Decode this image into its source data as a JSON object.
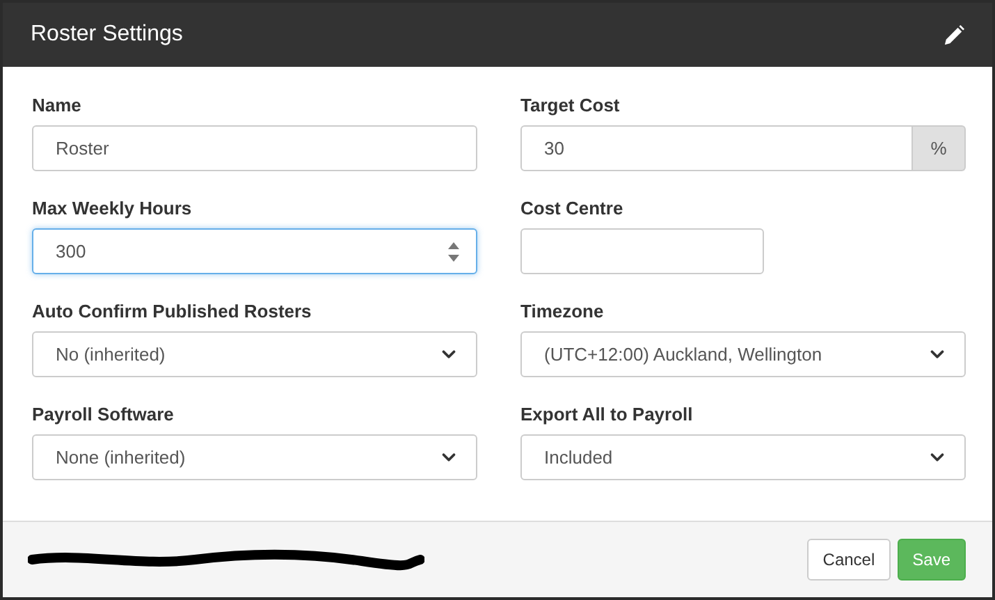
{
  "window": {
    "title": "Roster Settings"
  },
  "fields": [
    {
      "label": "Name",
      "kind": "text",
      "value": "Roster",
      "focused": false
    },
    {
      "label": "Target Cost",
      "kind": "addon",
      "value": "30",
      "addon": "%",
      "focused": false
    },
    {
      "label": "Max Weekly Hours",
      "kind": "number",
      "value": "300",
      "focused": true
    },
    {
      "label": "Cost Centre",
      "kind": "short",
      "focused": false
    },
    {
      "label": "Auto Confirm Published Rosters",
      "kind": "select",
      "value": "No (inherited)",
      "focused": false
    },
    {
      "label": "Timezone",
      "kind": "select",
      "value": "(UTC+12:00) Auckland, Wellington",
      "focused": false
    },
    {
      "label": "Payroll Software",
      "kind": "select",
      "value": "None (inherited)",
      "focused": false
    },
    {
      "label": "Export All to Payroll",
      "kind": "select",
      "value": "Included",
      "focused": false
    }
  ],
  "buttons": [
    {
      "label": "Cancel",
      "kind": "default"
    },
    {
      "label": "Save",
      "kind": "primary"
    }
  ]
}
